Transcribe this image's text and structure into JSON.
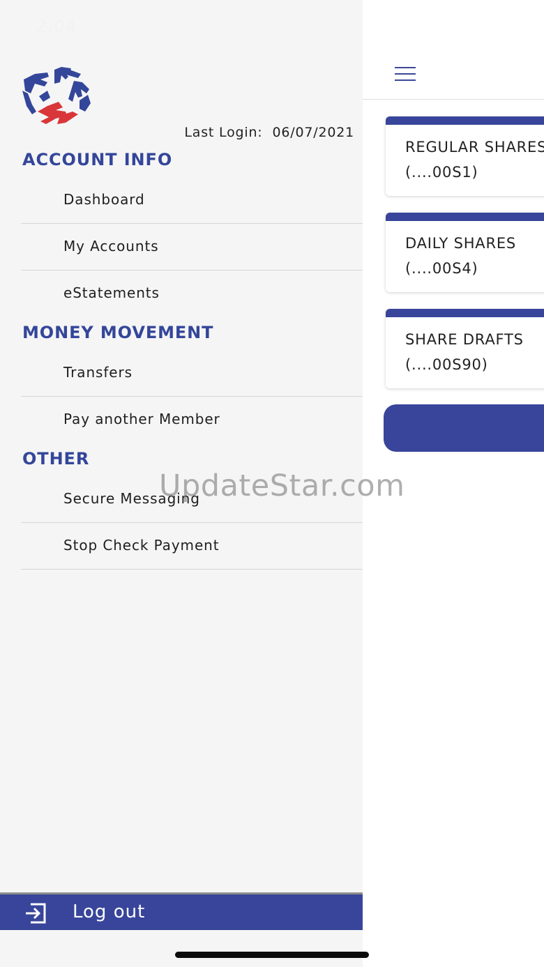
{
  "status_bar": {
    "time": "2:04"
  },
  "drawer": {
    "last_login_label": "Last Login:",
    "last_login_date": "06/07/2021",
    "sections": [
      {
        "heading": "ACCOUNT INFO",
        "items": [
          "Dashboard",
          "My Accounts",
          "eStatements"
        ]
      },
      {
        "heading": "MONEY MOVEMENT",
        "items": [
          "Transfers",
          "Pay another Member"
        ]
      },
      {
        "heading": "OTHER",
        "items": [
          "Secure Messaging",
          "Stop Check Payment"
        ]
      }
    ],
    "logout_label": "Log out"
  },
  "accounts": [
    {
      "name": "REGULAR SHARES",
      "number": "(....00S1)"
    },
    {
      "name": "DAILY SHARES",
      "number": "(....00S4)"
    },
    {
      "name": "SHARE DRAFTS",
      "number": "(....00S90)"
    }
  ],
  "watermark": "UpdateStar.com",
  "colors": {
    "brand_blue": "#38459a",
    "heading_blue": "#34469a",
    "logo_red": "#d9363a",
    "drawer_bg": "#f5f5f5"
  },
  "icons": {
    "menu": "hamburger-menu-icon",
    "logout": "logout-icon",
    "logo": "credit-union-hands-star-logo"
  }
}
